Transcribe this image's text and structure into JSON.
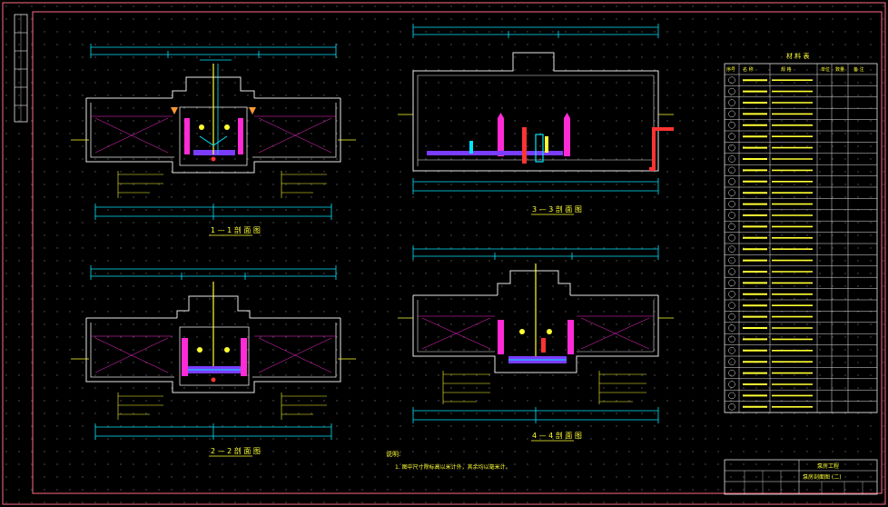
{
  "drawing": {
    "background": "#000000",
    "frame_color": "#ff6b8a",
    "line_color": "#e6e6e6",
    "dimension_color": "#00e5ff",
    "text_color": "#ffff33",
    "pipe_colors": [
      "#ff2bd6",
      "#7a3cff",
      "#ff3333",
      "#00e5ff",
      "#ffff33"
    ]
  },
  "views": [
    {
      "id": "section-1",
      "title": "1 — 1 剖 面 图"
    },
    {
      "id": "section-2",
      "title": "2 — 2 剖 面 图"
    },
    {
      "id": "section-3",
      "title": "3 — 3 剖 面 图"
    },
    {
      "id": "section-4",
      "title": "4 — 4 剖 面 图"
    }
  ],
  "notes": {
    "heading": "说明:",
    "line1": "1. 图中尺寸除标高以米计外，其余均以毫米计。"
  },
  "equipment_table": {
    "title": "材 料 表",
    "headers": [
      "序号",
      "名 称",
      "规 格",
      "单位",
      "数量",
      "备 注"
    ],
    "row_count": 30
  },
  "title_block": {
    "project": "泵房工程",
    "drawing_name": "泵房剖面图 (二)"
  }
}
